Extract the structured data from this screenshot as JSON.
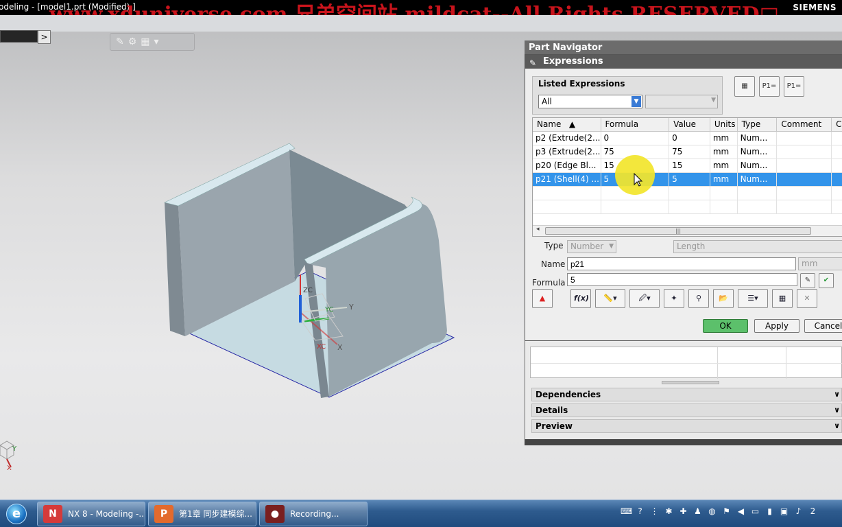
{
  "window": {
    "title": "odeling - [model1.prt (Modified) ]",
    "brand": "SIEMENS",
    "watermark": "www.xduniverse.com 兄弟空间站 mildcat--All Rights RESERVED□"
  },
  "viewport": {
    "expand_arrow": ">",
    "csys_labels": {
      "zc": "ZC",
      "yc": "YC",
      "xc": "XC",
      "y": "Y",
      "x": "X",
      "small_y": "Y",
      "small_x": "X"
    }
  },
  "navigator": {
    "title": "Part Navigator"
  },
  "dialog": {
    "title": "Expressions",
    "listed_expressions_label": "Listed Expressions",
    "filter_value": "All",
    "table": {
      "columns": [
        "Name",
        "Formula",
        "Value",
        "Units",
        "Type",
        "Comment",
        "C"
      ],
      "sort_indicator": "▲",
      "rows": [
        {
          "name": "p2  (Extrude(2...",
          "formula": "0",
          "value": "0",
          "units": "mm",
          "type": "Num..."
        },
        {
          "name": "p3  (Extrude(2...",
          "formula": "75",
          "value": "75",
          "units": "mm",
          "type": "Num..."
        },
        {
          "name": "p20  (Edge Bl...",
          "formula": "15",
          "value": "15",
          "units": "mm",
          "type": "Num..."
        },
        {
          "name": "p21  (Shell(4) ...",
          "formula": "5",
          "value": "5",
          "units": "mm",
          "type": "Num..."
        }
      ],
      "selected_row": 3
    },
    "type_label": "Type",
    "type_value": "Number",
    "dimension_value": "Length",
    "name_label": "Name",
    "name_value": "p21",
    "units_value": "mm",
    "formula_label": "Formula",
    "formula_value": "5",
    "fx_label": "f(x)",
    "ok_label": "OK",
    "apply_label": "Apply",
    "cancel_label": "Cancel"
  },
  "sections": {
    "dependencies": "Dependencies",
    "details": "Details",
    "preview": "Preview"
  },
  "taskbar": {
    "items": [
      {
        "label": "NX 8 - Modeling -..."
      },
      {
        "label": "第1章 同步建模综..."
      },
      {
        "label": "Recording..."
      }
    ],
    "clock_fragment": "2"
  }
}
